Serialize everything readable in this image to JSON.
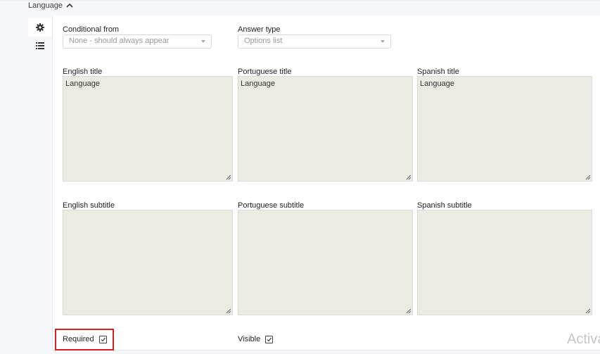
{
  "section": {
    "title": "Language"
  },
  "sidebar": {
    "tabs": [
      {
        "icon": "gear-icon"
      },
      {
        "icon": "list-icon"
      }
    ]
  },
  "conditional_from": {
    "label": "Conditional from",
    "value": "None - should always appear"
  },
  "answer_type": {
    "label": "Answer type",
    "value": "Options list"
  },
  "titles": [
    {
      "label": "English title",
      "value": "Language"
    },
    {
      "label": "Portuguese title",
      "value": "Language"
    },
    {
      "label": "Spanish title",
      "value": "Language"
    }
  ],
  "subtitles": [
    {
      "label": "English subtitle",
      "value": ""
    },
    {
      "label": "Portuguese subtitle",
      "value": ""
    },
    {
      "label": "Spanish subtitle",
      "value": ""
    }
  ],
  "required": {
    "label": "Required",
    "checked": true
  },
  "visible": {
    "label": "Visible",
    "checked": true
  },
  "watermark": "Activa",
  "colors": {
    "textarea_bg": "#ebeae3",
    "highlight": "#d42026"
  }
}
